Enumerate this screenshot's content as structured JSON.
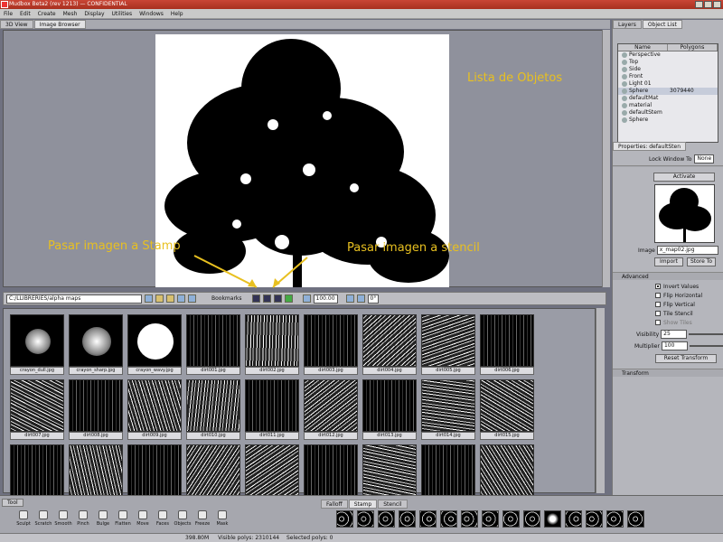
{
  "window": {
    "title": "Mudbox Beta2 (rev 1213) — CONFIDENTIAL"
  },
  "menu": [
    "File",
    "Edit",
    "Create",
    "Mesh",
    "Display",
    "Utilities",
    "Windows",
    "Help"
  ],
  "view_tabs": [
    "3D View",
    "Image Browser"
  ],
  "annotations": {
    "object_list": "Lista de Objetos",
    "stamp": "Pasar imagen a Stamp",
    "stencil": "Pasar imagen a stencil"
  },
  "browser_toolbar": {
    "path": "C:/LLIBRERIES/alpha maps",
    "bookmarks_label": "Bookmarks",
    "zoom": "100.00",
    "rotation": "0°"
  },
  "thumbnails": [
    "crayon_dull.jpg",
    "crayon_sharp.jpg",
    "crayon_wavy.jpg",
    "dirt001.jpg",
    "dirt002.jpg",
    "dirt003.jpg",
    "dirt004.jpg",
    "dirt005.jpg",
    "dirt006.jpg",
    "dirt007.jpg",
    "dirt008.jpg",
    "dirt009.jpg",
    "dirt010.jpg",
    "dirt011.jpg",
    "dirt012.jpg",
    "dirt013.jpg",
    "dirt014.jpg",
    "dirt015.jpg",
    "",
    "",
    "",
    "",
    "",
    "",
    "",
    "",
    ""
  ],
  "right_panel": {
    "tabs": [
      "Layers",
      "Object List"
    ],
    "columns": [
      "Name",
      "Polygons"
    ],
    "objects": [
      {
        "name": "Perspective",
        "polys": ""
      },
      {
        "name": "Top",
        "polys": ""
      },
      {
        "name": "Side",
        "polys": ""
      },
      {
        "name": "Front",
        "polys": ""
      },
      {
        "name": "Light 01",
        "polys": ""
      },
      {
        "name": "Sphere",
        "polys": "3079440"
      },
      {
        "name": "defaultMat",
        "polys": ""
      },
      {
        "name": "material",
        "polys": ""
      },
      {
        "name": "defaultStem",
        "polys": ""
      },
      {
        "name": "Sphere",
        "polys": ""
      }
    ],
    "properties_tab": "Properties: defaultSten",
    "lock_label": "Lock Window To",
    "lock_value": "None",
    "activate": "Activate",
    "image_label": "Image",
    "image_value": "x_map02.jpg",
    "import": "Import",
    "store_to": "Store To",
    "advanced": "Advanced",
    "checkboxes": [
      {
        "label": "Invert Values",
        "checked": true
      },
      {
        "label": "Flip Horizontal",
        "checked": false
      },
      {
        "label": "Flip Vertical",
        "checked": false
      },
      {
        "label": "Tile Stencil",
        "checked": false
      },
      {
        "label": "Show Tiles",
        "checked": false
      }
    ],
    "visibility_label": "Visibility",
    "visibility_value": "25",
    "multiplier_label": "Multiplier",
    "multiplier_value": "100",
    "reset_transform": "Reset Transform",
    "transform": "Transform"
  },
  "tool_panel": {
    "title": "Tool",
    "tools": [
      "Sculpt",
      "Scratch",
      "Smooth",
      "Pinch",
      "Bulge",
      "Flatten",
      "Move",
      "Faces",
      "Objects",
      "Freeze",
      "Mask"
    ]
  },
  "stamp_tabs": [
    "Falloff",
    "Stamp",
    "Stencil"
  ],
  "status": {
    "memory": "398.80M",
    "visible_polys": "Visible polys: 2310144",
    "selected_polys": "Selected polys: 0"
  }
}
